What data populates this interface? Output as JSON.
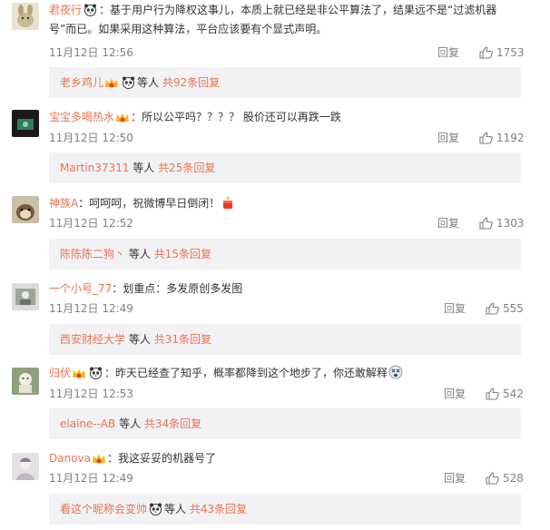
{
  "comments": [
    {
      "username": "君夜行",
      "text": "：基于用户行为降权这事儿，本质上就已经是非公平算法了，结果远不是“过滤机器号”而已。如果采用这种算法，平台应该要有个显式声明。",
      "time": "11月12日 12:56",
      "reply_label": "回复",
      "likes": "1753",
      "reply_summary": {
        "user": "老乡鸡儿",
        "mid": "等人",
        "count": "共92条回复"
      }
    },
    {
      "username": "宝宝多喝热水",
      "text": "：所以公平吗？？？？ 股价还可以再跌一跌",
      "time": "11月12日 12:50",
      "reply_label": "回复",
      "likes": "1192",
      "reply_summary": {
        "user": "Martin37311",
        "mid": "等人",
        "count": "共25条回复"
      }
    },
    {
      "username": "神族A",
      "text": "：呵呵呵，祝微博早日倒闭！",
      "time": "11月12日 12:52",
      "reply_label": "回复",
      "likes": "1303",
      "reply_summary": {
        "user": "陈陈陈二狗丶",
        "mid": "等人",
        "count": "共15条回复"
      }
    },
    {
      "username": "一个小号_77",
      "text": "：划重点：多发原创多发图",
      "time": "11月12日 12:49",
      "reply_label": "回复",
      "likes": "555",
      "reply_summary": {
        "user": "西安财经大学",
        "mid": "等人",
        "count": "共31条回复"
      }
    },
    {
      "username": "归伏",
      "text": "：昨天已经查了知乎，概率都降到这个地步了，你还敢解释",
      "time": "11月12日 12:53",
      "reply_label": "回复",
      "likes": "542",
      "reply_summary": {
        "user": "elaine--AB",
        "mid": "等人",
        "count": "共34条回复"
      }
    },
    {
      "username": "Danova",
      "text": "：我这妥妥的机器号了",
      "time": "11月12日 12:49",
      "reply_label": "回复",
      "likes": "528",
      "reply_summary": {
        "user": "看这个昵称会变帅",
        "mid": "等人",
        "count": "共43条回复"
      }
    }
  ],
  "colors": {
    "username": "#eb7350",
    "meta": "#808080",
    "reply_box_bg": "#f2f2f5"
  }
}
